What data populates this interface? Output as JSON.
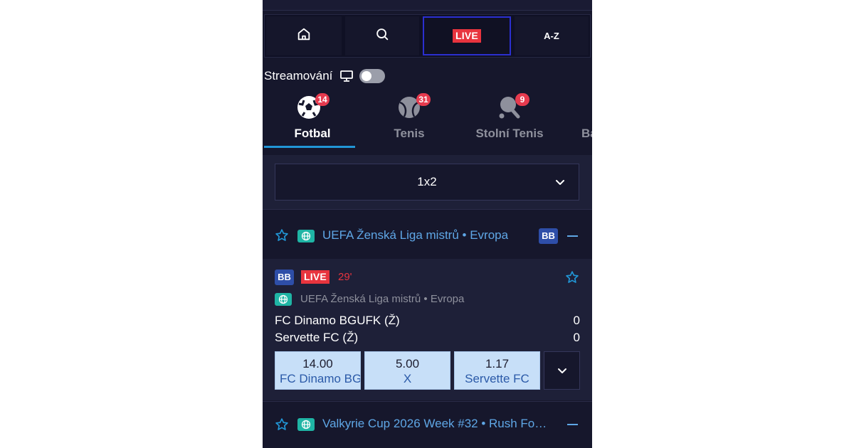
{
  "nav": {
    "home_icon": "home-icon",
    "search_icon": "search-icon",
    "live_label": "LIVE",
    "az_label": "A-Z"
  },
  "streaming": {
    "label": "Streamování",
    "icon": "monitor-icon",
    "enabled": false
  },
  "sports": [
    {
      "label": "Fotbal",
      "count": "14",
      "icon": "soccer-ball-icon",
      "active": true
    },
    {
      "label": "Tenis",
      "count": "31",
      "icon": "tennis-ball-icon",
      "active": false
    },
    {
      "label": "Stolní Tenis",
      "count": "9",
      "icon": "table-tennis-icon",
      "active": false
    },
    {
      "label": "Ba",
      "count": "",
      "icon": "",
      "active": false
    }
  ],
  "market": {
    "value": "1x2"
  },
  "leagues": [
    {
      "title": "UEFA Ženská Liga mistrů • Evropa",
      "badge": "BB"
    },
    {
      "title": "Valkyrie Cup 2026 Week #32 • Rush Fo…",
      "badge": ""
    }
  ],
  "match": {
    "badge": "BB",
    "live_label": "LIVE",
    "minute": "29'",
    "competition": "UEFA Ženská Liga mistrů • Evropa",
    "home_team": "FC Dinamo BGUFK (Ž)",
    "away_team": "Servette FC (Ž)",
    "home_score": "0",
    "away_score": "0",
    "odds": [
      {
        "price": "14.00",
        "label": "FC Dinamo BGUFK"
      },
      {
        "price": "5.00",
        "label": "X"
      },
      {
        "price": "1.17",
        "label": "Servette FC"
      }
    ]
  },
  "colors": {
    "background": "#16172c",
    "accent": "#2196d6",
    "live": "#e8343e",
    "badge": "#e63a4e",
    "odds_bg": "#c7dff8",
    "link": "#5fa7e6"
  }
}
